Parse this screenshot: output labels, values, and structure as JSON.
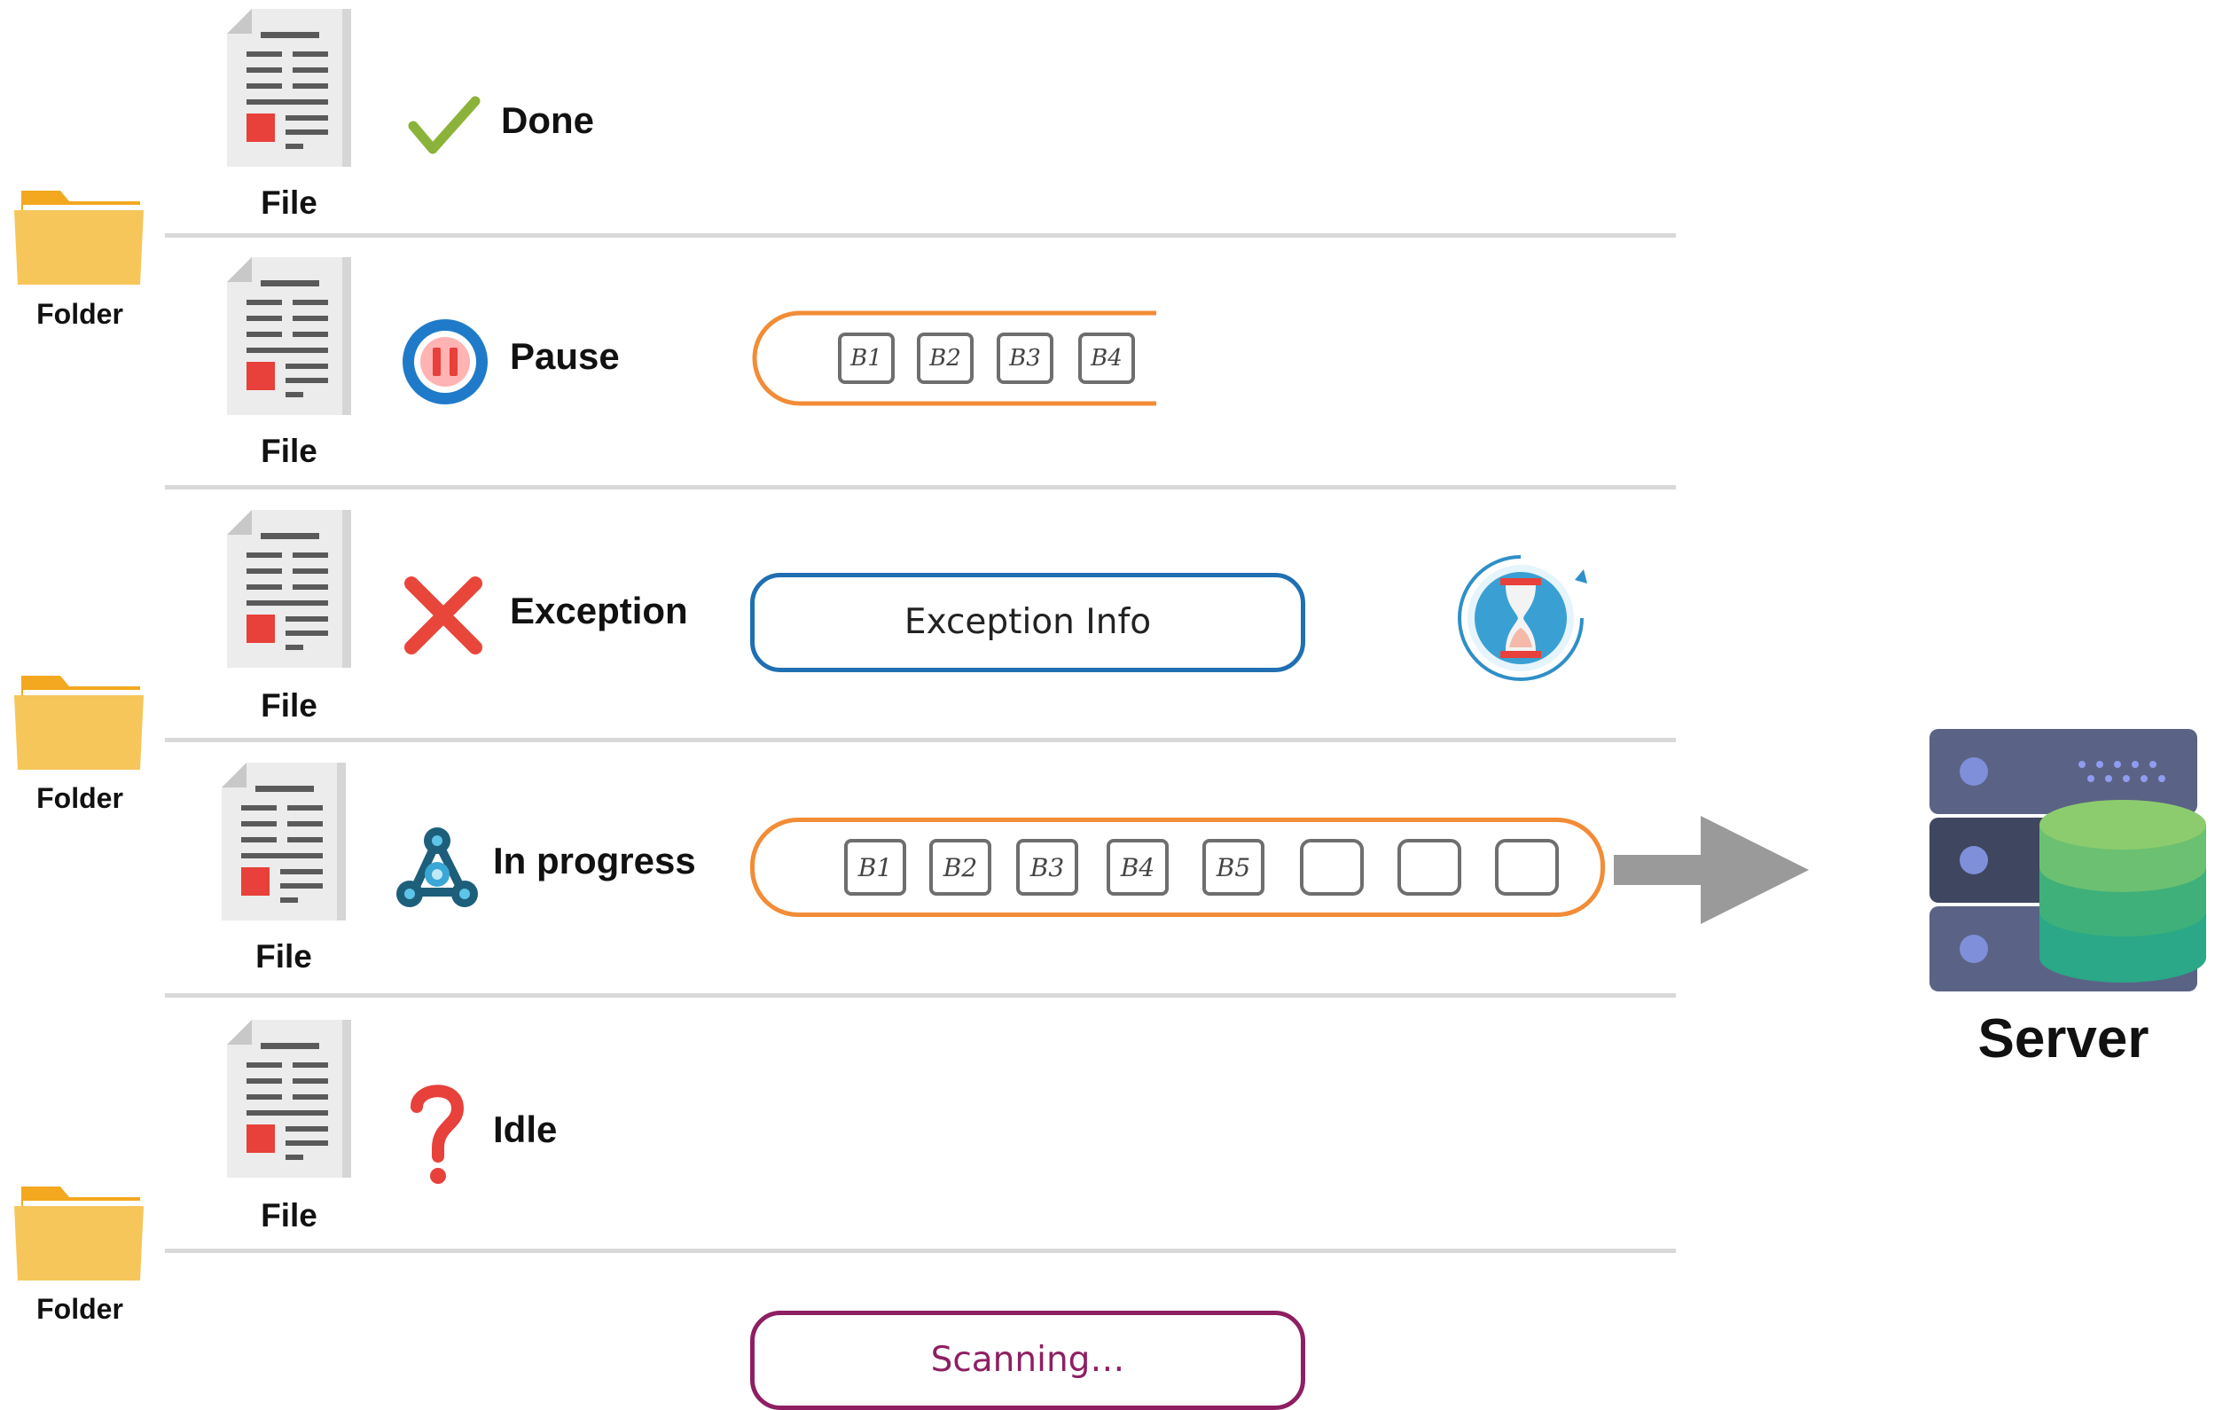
{
  "colors": {
    "divider": "#d9d9d9",
    "orange": "#f28c36",
    "blue": "#1f6fb2",
    "purple": "#8e1f63",
    "arrow": "#9a9a9a",
    "folder": "#f6c65a",
    "check": "#8bb33a",
    "cross": "#e8463b"
  },
  "labels": {
    "folder": "Folder",
    "file": "File",
    "server": "Server"
  },
  "statuses": {
    "done": "Done",
    "pause": "Pause",
    "exception": "Exception",
    "in_progress": "In progress",
    "idle": "Idle"
  },
  "pause_blocks": [
    "B1",
    "B2",
    "B3",
    "B4"
  ],
  "progress_blocks": [
    "B1",
    "B2",
    "B3",
    "B4",
    "B5",
    "",
    "",
    ""
  ],
  "exception_info": "Exception Info",
  "scanning": "Scanning…"
}
